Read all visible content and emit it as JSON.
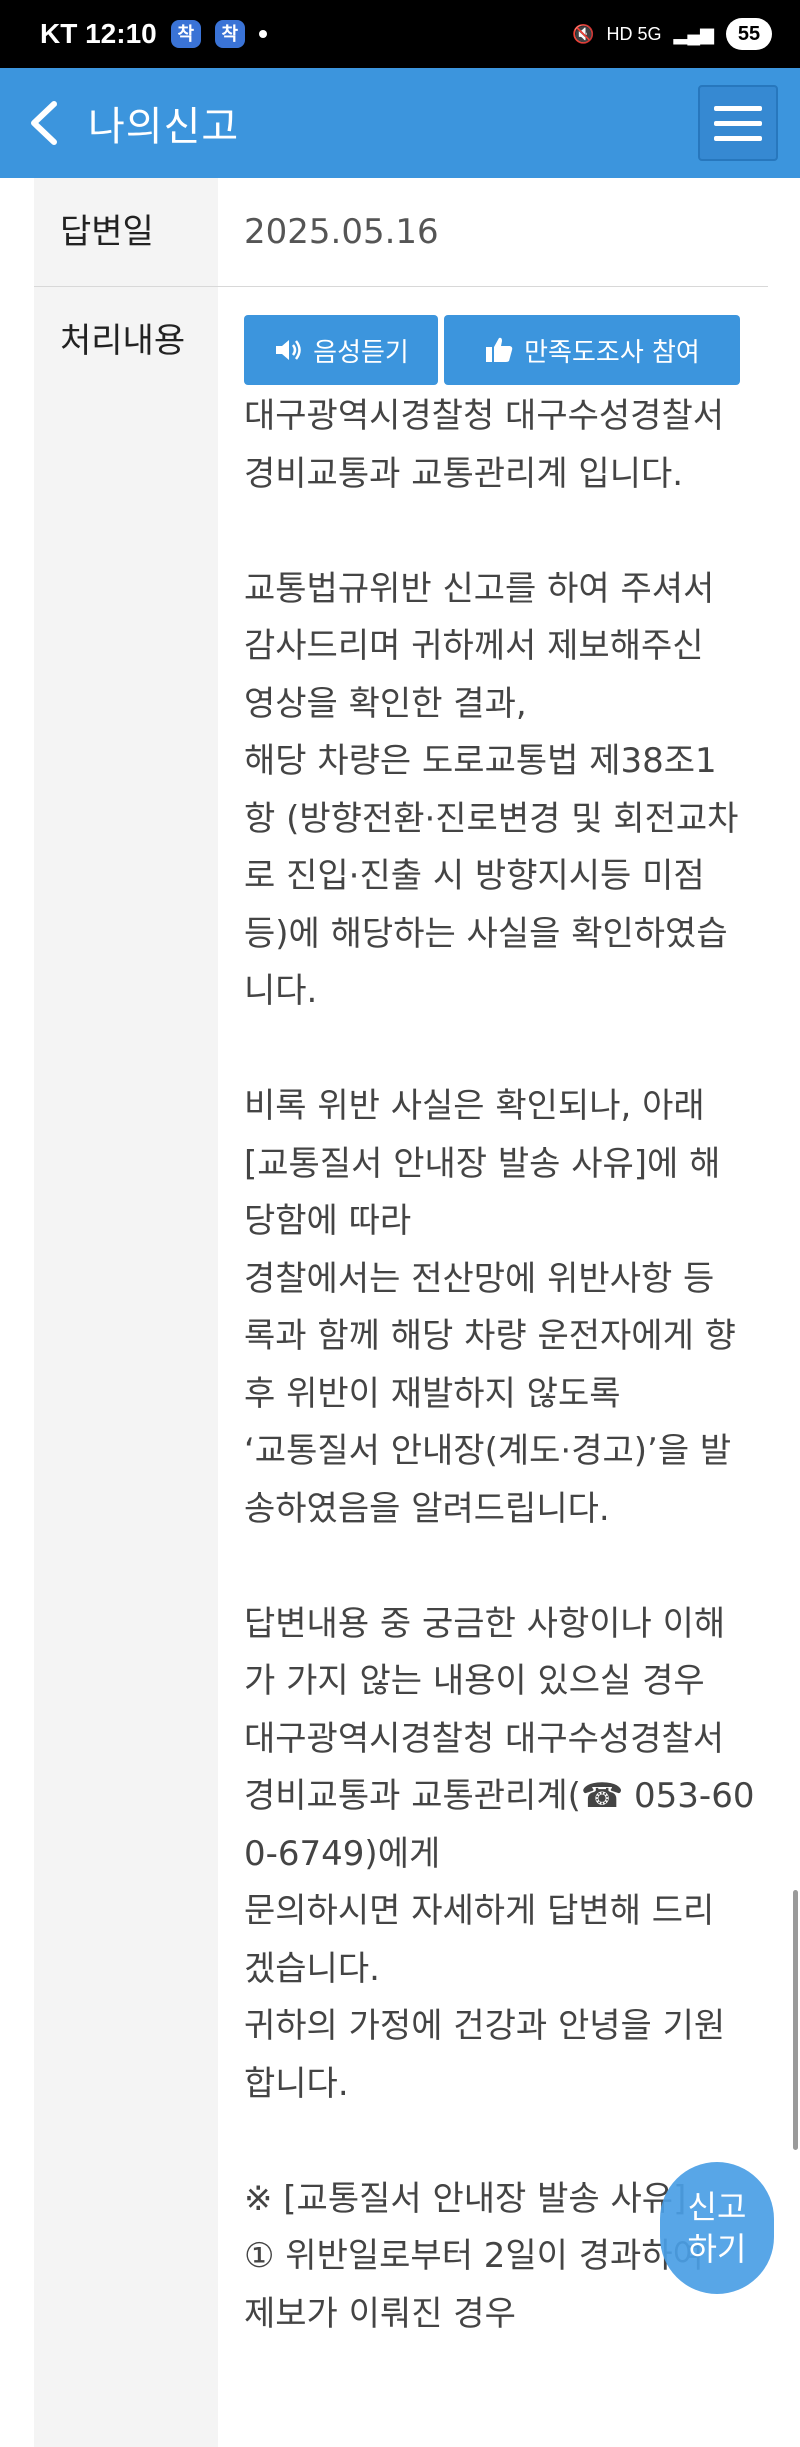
{
  "status_bar": {
    "carrier_time": "KT 12:10",
    "chip1": "착",
    "chip2": "착",
    "network": "HD 5G",
    "battery": "55"
  },
  "header": {
    "title": "나의신고"
  },
  "details": {
    "answer_date_label": "답변일",
    "answer_date_value": "2025.05.16",
    "process_label": "처리내용",
    "voice_button": "음성듣기",
    "survey_button": "만족도조사 참여",
    "answer_text": "대구광역시경찰청 대구수성경찰서\n경비교통과 교통관리계 입니다.\n\n교통법규위반 신고를 하여 주셔서\n감사드리며 귀하께서 제보해주신\n영상을 확인한 결과,\n해당 차량은 도로교통법 제38조1\n항 (방향전환·진로변경 및 회전교차\n로 진입·진출 시 방향지시등 미점\n등)에 해당하는 사실을 확인하였습\n니다.\n\n비록 위반 사실은 확인되나, 아래\n[교통질서 안내장 발송 사유]에 해\n당함에 따라\n경찰에서는 전산망에 위반사항 등\n록과 함께 해당 차량 운전자에게 향\n후 위반이 재발하지 않도록\n‘교통질서 안내장(계도·경고)’을 발\n송하였음을 알려드립니다.\n\n답변내용 중 궁금한 사항이나 이해\n가 가지 않는 내용이 있으실 경우\n대구광역시경찰청 대구수성경찰서\n경비교통과 교통관리계(☎ 053-60\n0-6749)에게\n문의하시면 자세하게 답변해 드리\n겠습니다.\n귀하의 가정에 건강과 안녕을 기원\n합니다.\n\n※ [교통질서 안내장 발송 사유]\n① 위반일로부터 2일이 경과하여\n제보가 이뤄진 경우"
  },
  "fab": {
    "line1": "신고",
    "line2": "하기"
  }
}
